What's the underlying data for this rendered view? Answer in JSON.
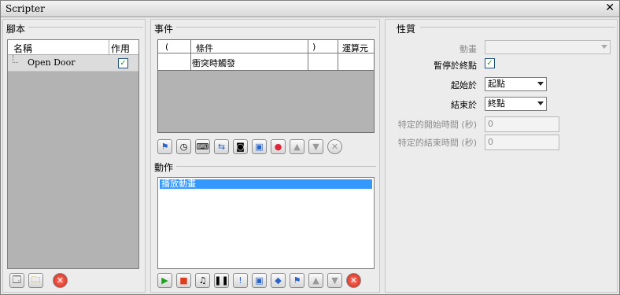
{
  "window": {
    "title": "Scripter",
    "close_glyph": "✕"
  },
  "script_panel": {
    "title": "腳本",
    "columns": [
      "名稱",
      "作用中"
    ],
    "items": [
      {
        "name": "Open Door",
        "active": true
      }
    ],
    "buttons": [
      "add-script-icon",
      "add-folder-icon",
      "delete-icon"
    ]
  },
  "events_panel": {
    "title": "事件",
    "columns": [
      "(",
      "條件",
      ")",
      "運算元"
    ],
    "rows": [
      {
        "open": "",
        "condition": "衝突時觸發",
        "close": "",
        "operator": ""
      }
    ],
    "toolbar": [
      "event-clock",
      "event-timer",
      "event-key",
      "event-camera",
      "event-collision",
      "event-record",
      "move-up",
      "move-down",
      "delete"
    ]
  },
  "actions_panel": {
    "title": "動作",
    "items": [
      "播放動畫"
    ],
    "toolbar": [
      "play",
      "stop",
      "sound",
      "pause",
      "message",
      "image",
      "object",
      "script",
      "move-up",
      "move-down",
      "delete"
    ]
  },
  "properties_panel": {
    "title": "性質",
    "animation_label": "動畫",
    "pause_at_end_label": "暫停於終點",
    "pause_at_end_checked": true,
    "start_at_label": "起始於",
    "start_at_value": "起點",
    "end_at_label": "結束於",
    "end_at_value": "終點",
    "specific_start_label": "特定的開始時間 (秒)",
    "specific_start_value": "0",
    "specific_end_label": "特定的結束時間 (秒)",
    "specific_end_value": "0"
  }
}
